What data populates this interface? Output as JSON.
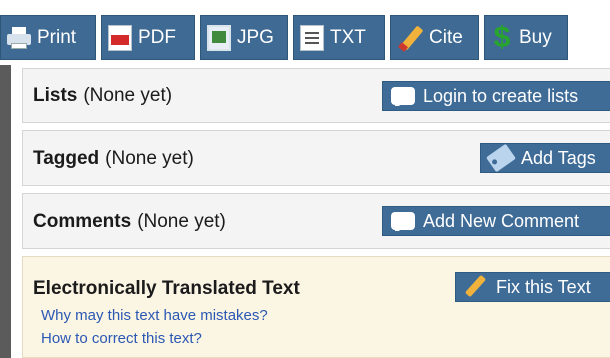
{
  "toolbar": {
    "buttons": [
      {
        "label": "Print",
        "icon": "printer-icon"
      },
      {
        "label": "PDF",
        "icon": "pdf-icon"
      },
      {
        "label": "JPG",
        "icon": "image-icon"
      },
      {
        "label": "TXT",
        "icon": "text-file-icon"
      },
      {
        "label": "Cite",
        "icon": "pencil-icon"
      },
      {
        "label": "Buy",
        "icon": "dollar-icon"
      }
    ]
  },
  "lists": {
    "title": "Lists",
    "status": "(None yet)",
    "button": "Login to create lists"
  },
  "tagged": {
    "title": "Tagged",
    "status": "(None yet)",
    "button": "Add Tags"
  },
  "comments": {
    "title": "Comments",
    "status": "(None yet)",
    "button": "Add New Comment"
  },
  "translated": {
    "title": "Electronically Translated Text",
    "button": "Fix this Text",
    "links": [
      "Why may this text have mistakes?",
      "How to correct this text?"
    ]
  },
  "colors": {
    "button_blue": "#3f6c97",
    "translated_bg": "#fbf5e4",
    "link": "#2b58b3"
  }
}
